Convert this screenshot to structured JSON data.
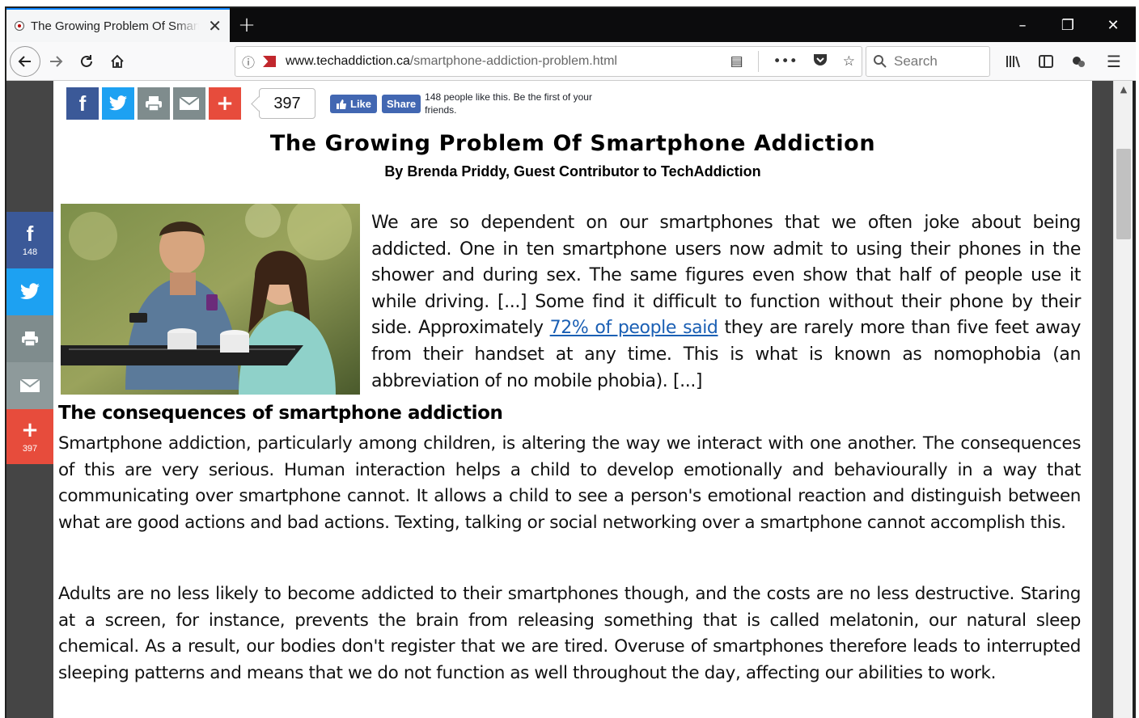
{
  "browser": {
    "tab_title": "The Growing Problem Of Smartphone Addiction",
    "new_tab": "+",
    "window_controls": [
      "–",
      "❐",
      "✕"
    ],
    "url_domain": "www.techaddiction.ca",
    "url_path": "/smartphone-addiction-problem.html",
    "search_placeholder": "Search",
    "icons": [
      "back-icon",
      "forward-icon",
      "reload-icon",
      "home-icon",
      "info-icon",
      "reader-icon",
      "more-icon",
      "pocket-icon",
      "star-icon",
      "search-icon",
      "library-icon",
      "sidebar-icon",
      "extension-icon",
      "menu-icon"
    ]
  },
  "share": {
    "total_count": "397",
    "fb_like_label": "Like",
    "fb_share_label": "Share",
    "fb_text": "148 people like this. Be the first of your friends.",
    "side_fb_count": "148",
    "side_total_count": "397"
  },
  "article": {
    "title": "The Growing Problem Of Smartphone Addiction",
    "byline": "By Brenda Priddy, Guest Contributor to TechAddiction",
    "p1_before_link": "We are so dependent on our smartphones that we often joke about being addicted. One in ten smartphone users now admit to using their phones in the shower and during sex. The same figures even show that half of people use it while driving. [...] Some find it difficult to function without their phone by their side. Approximately ",
    "p1_link": "72% of people said",
    "p1_after_link": " they are rarely more than five feet away from their handset at any time. This is what is known as nomophobia (an abbreviation of no mobile phobia). [...]",
    "heading": "The consequences of smartphone addiction",
    "p2": "Smartphone addiction, particularly among children, is altering the way we interact with one another. The consequences of this are very serious. Human interaction helps a child to develop emotionally and behaviourally in a way that communicating over smartphone cannot. It allows a child to see a person's emotional reaction and distinguish between what are good actions and bad actions. Texting, talking or social networking over a smartphone cannot accomplish this.",
    "p3": "Adults are no less likely to become addicted to their smartphones though, and the costs are no less destructive. Staring at a screen, for instance, prevents the brain from releasing something that is called melatonin, our natural sleep chemical. As a result, our bodies don't register that we are tired. Overuse of smartphones therefore leads to interrupted sleeping patterns and means that we do not function as well throughout the day, affecting our abilities to work."
  },
  "colors": {
    "facebook": "#3b5998",
    "twitter": "#1da1f2",
    "grey": "#7f8c8d",
    "plus": "#e74c3c",
    "link": "#1a5fb4"
  }
}
